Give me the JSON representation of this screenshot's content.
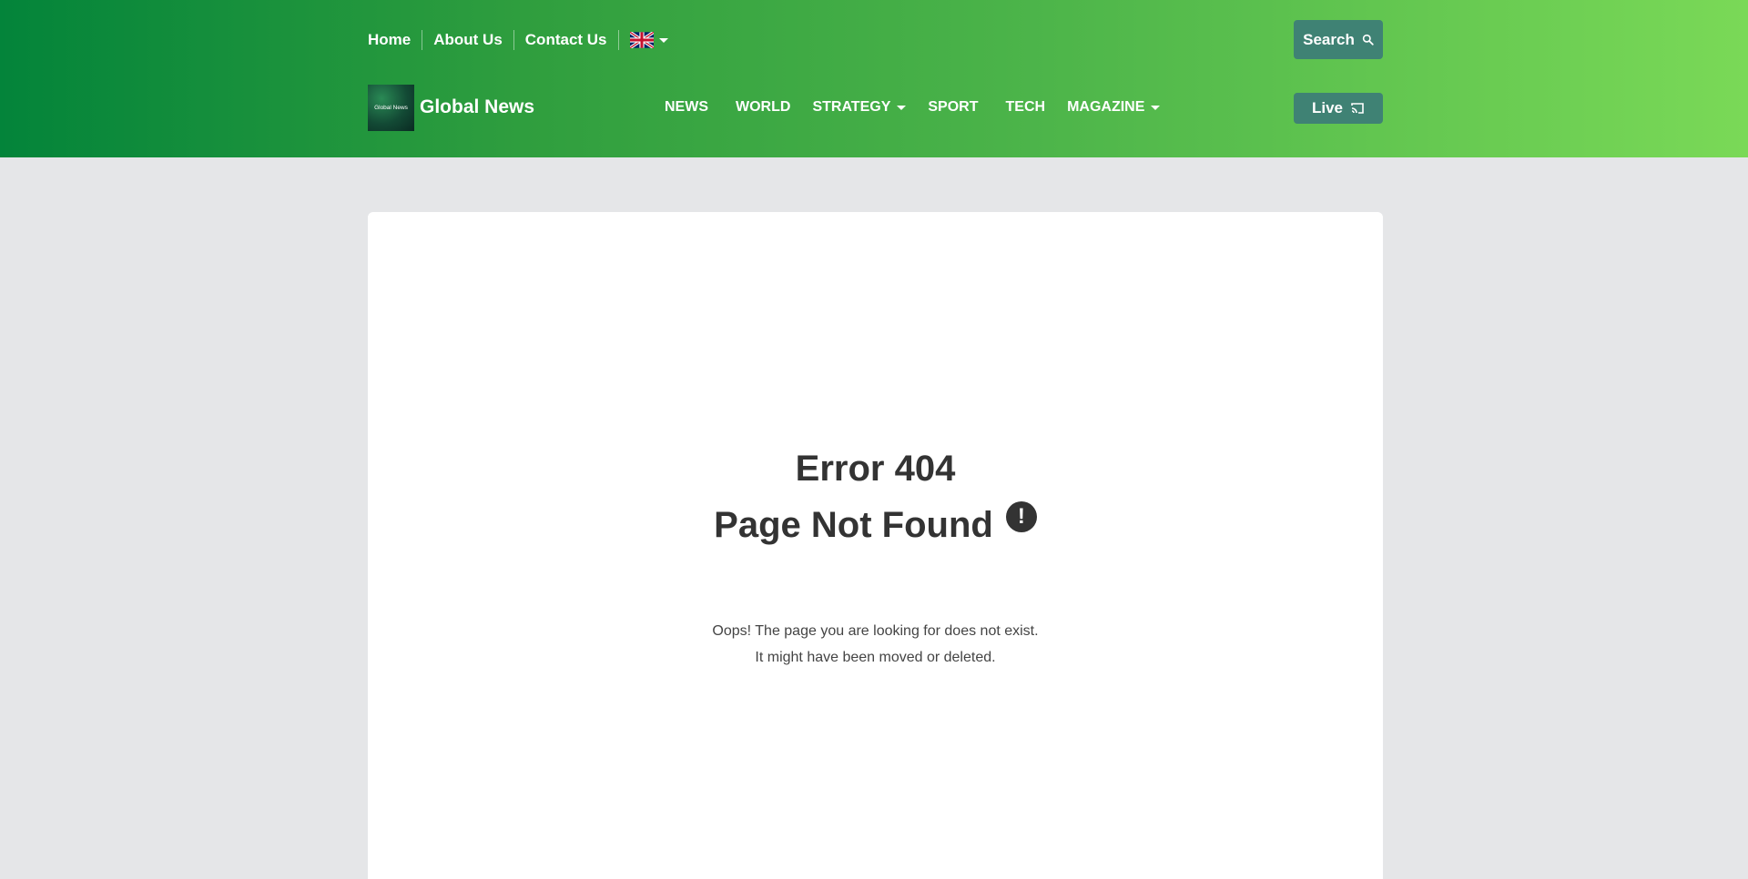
{
  "colors": {
    "header_gradient_start": "#03843a",
    "header_gradient_end": "#7ad957",
    "teal_button": "#3f8274",
    "page_background": "#e5e6e8"
  },
  "topbar": {
    "links": [
      "Home",
      "About Us",
      "Contact Us"
    ],
    "language_icon": "uk-flag-icon",
    "search_label": "Search"
  },
  "brand": {
    "logo_text": "Global News",
    "name": "Global News"
  },
  "nav": {
    "items": [
      {
        "label": "NEWS",
        "dropdown": false
      },
      {
        "label": "WORLD",
        "dropdown": false
      },
      {
        "label": "STRATEGY",
        "dropdown": true
      },
      {
        "label": "SPORT",
        "dropdown": false
      },
      {
        "label": "TECH",
        "dropdown": false
      },
      {
        "label": "MAGAZINE",
        "dropdown": true
      }
    ],
    "live_label": "Live"
  },
  "error": {
    "code_title": "Error 404",
    "message_title": "Page Not Found",
    "line1": "Oops! The page you are looking for does not exist.",
    "line2": "It might have been moved or deleted."
  }
}
